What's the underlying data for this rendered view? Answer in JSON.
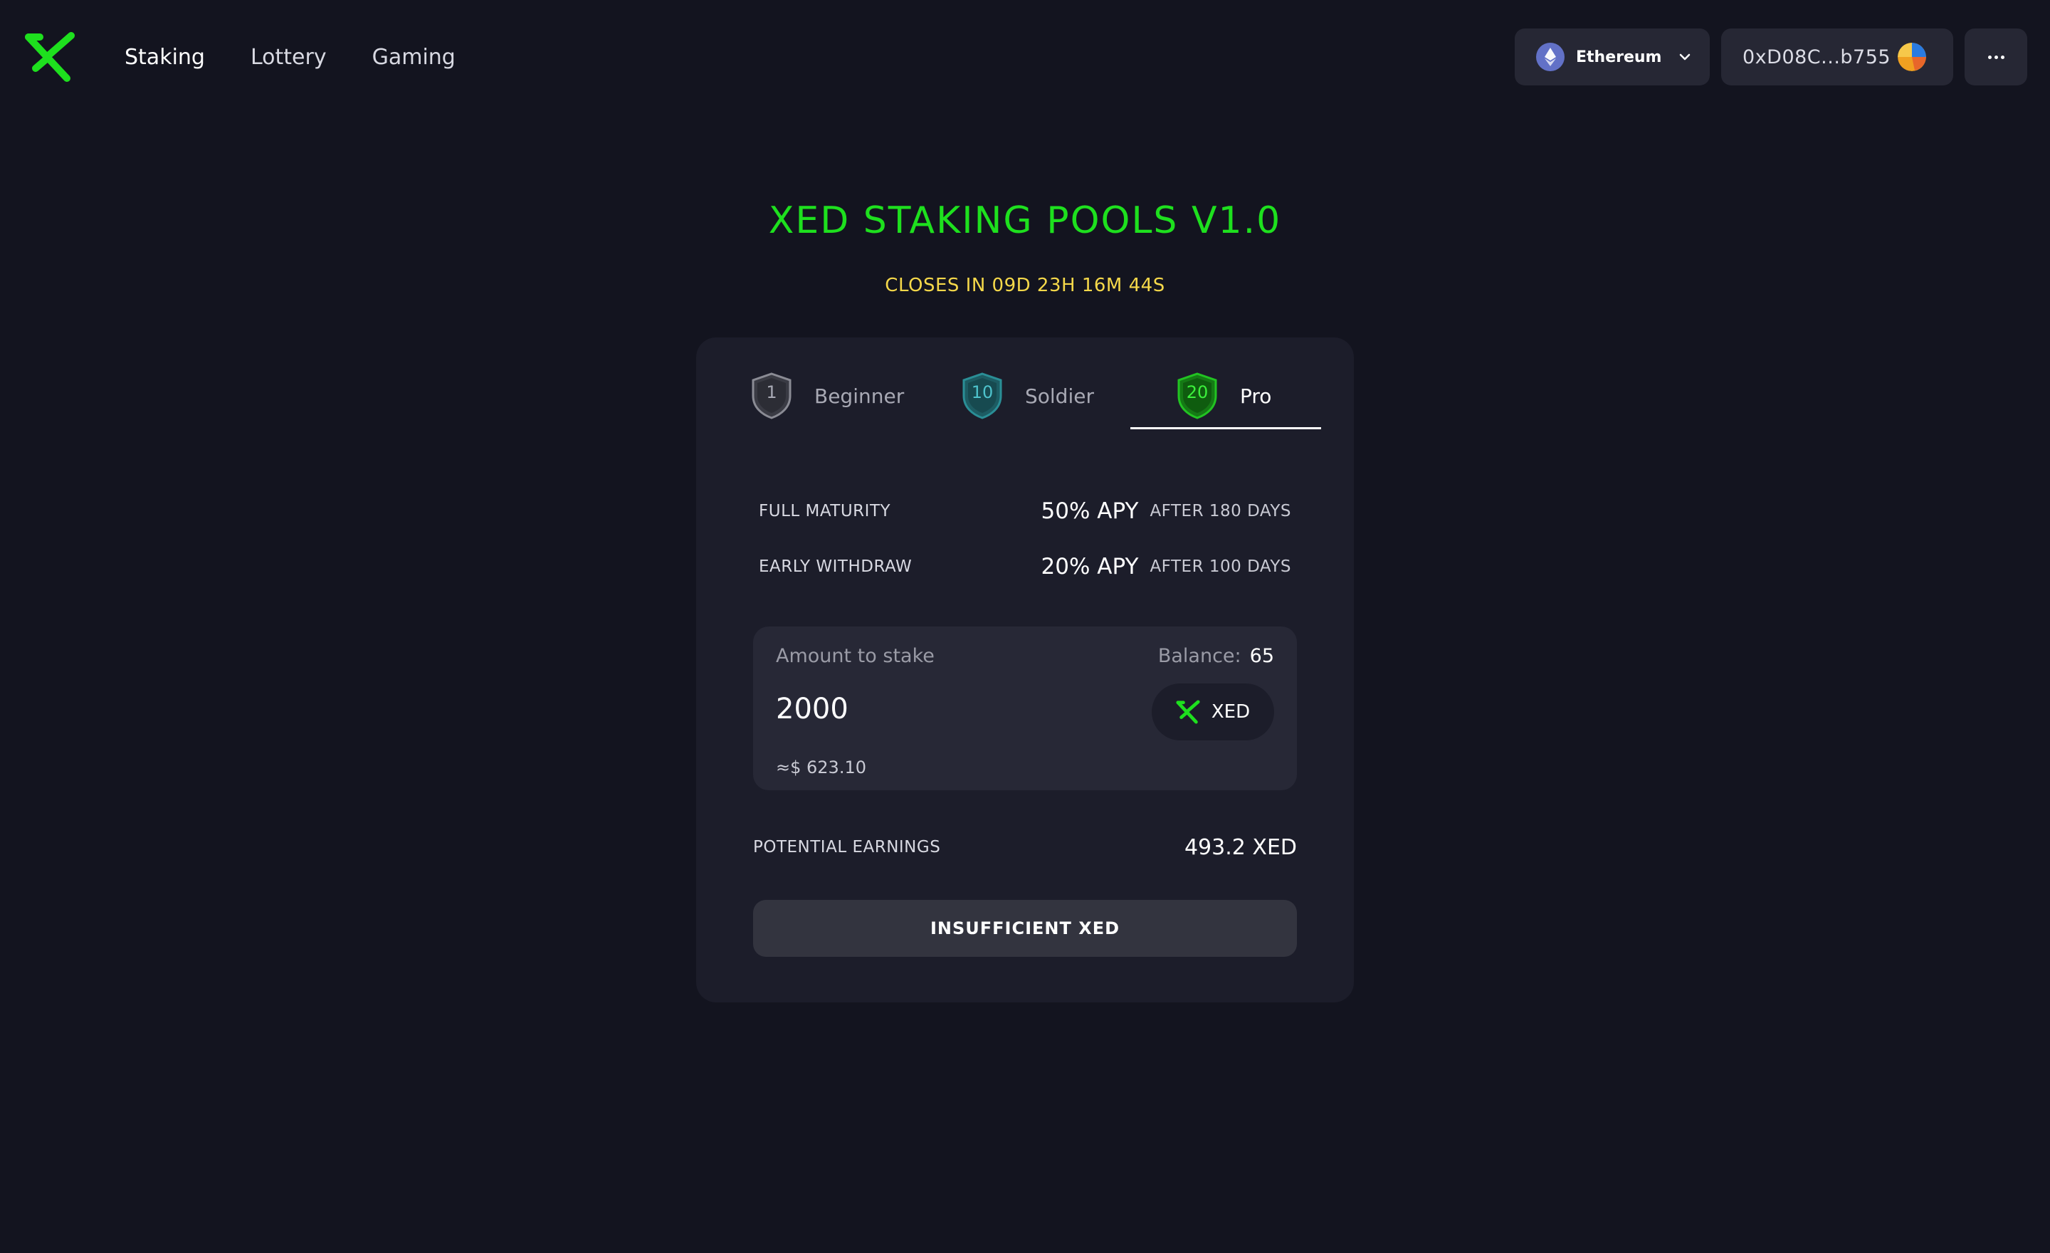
{
  "header": {
    "nav": [
      {
        "label": "Staking",
        "active": true
      },
      {
        "label": "Lottery",
        "active": false
      },
      {
        "label": "Gaming",
        "active": false
      }
    ],
    "network": {
      "label": "Ethereum",
      "icon": "ethereum-icon"
    },
    "wallet": {
      "address": "0xD08C...b755",
      "avatar": "wallet-avatar-icon"
    },
    "more": {
      "icon": "more-icon"
    }
  },
  "main": {
    "title": "XED STAKING POOLS V1.0",
    "countdown": "CLOSES IN 09D 23H 16M 44S"
  },
  "card": {
    "tabs": [
      {
        "label": "Beginner",
        "badge": "1",
        "color": "#8a8b94",
        "active": false
      },
      {
        "label": "Soldier",
        "badge": "10",
        "color": "#2a8e96",
        "active": false
      },
      {
        "label": "Pro",
        "badge": "20",
        "color": "#22c322",
        "active": true
      }
    ],
    "rates": [
      {
        "label": "FULL MATURITY",
        "apy": "50% APY",
        "after": "AFTER 180 DAYS"
      },
      {
        "label": "EARLY WITHDRAW",
        "apy": "20% APY",
        "after": "AFTER 100 DAYS"
      }
    ],
    "stake": {
      "label": "Amount to stake",
      "balance_label": "Balance:",
      "balance_value": "65",
      "amount": "2000",
      "token": "XED",
      "usd_value": "≈$ 623.10"
    },
    "earnings": {
      "label": "POTENTIAL EARNINGS",
      "value": "493.2 XED"
    },
    "submit_label": "INSUFFICIENT XED"
  },
  "colors": {
    "background": "#13141f",
    "card": "#1c1d2a",
    "accent_green": "#1ee01e",
    "countdown_yellow": "#f5d84a"
  }
}
